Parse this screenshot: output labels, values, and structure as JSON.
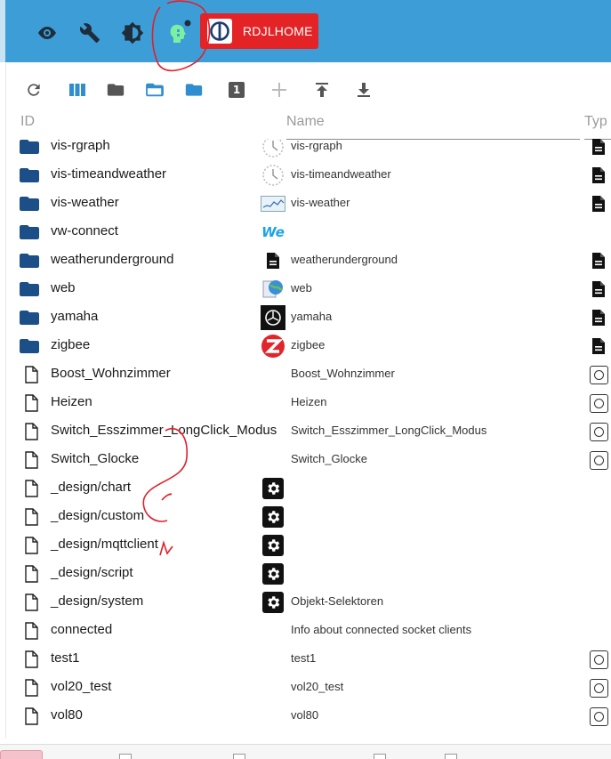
{
  "appbar": {
    "icons": [
      "eye-icon",
      "wrench-icon",
      "brightness-icon",
      "expert-mode-icon"
    ],
    "brand_label": "RDJLHOME"
  },
  "toolbar": {
    "icons": [
      "refresh-icon",
      "columns-icon",
      "folder-icon",
      "folder-open-icon",
      "folder-blue-icon",
      "number-badge-icon",
      "add-icon",
      "upload-icon",
      "download-icon"
    ],
    "badge_value": "1"
  },
  "columns": {
    "id": "ID",
    "name": "Name",
    "type": "Typ"
  },
  "rows": [
    {
      "id": "vis-rgraph",
      "name": "vis-rgraph",
      "kind": "folder",
      "name_icon": "clock-icon",
      "type_icon": "document-icon"
    },
    {
      "id": "vis-timeandweather",
      "name": "vis-timeandweather",
      "kind": "folder",
      "name_icon": "clock-icon",
      "type_icon": "document-icon"
    },
    {
      "id": "vis-weather",
      "name": "vis-weather",
      "kind": "folder",
      "name_icon": "weather-chart-icon",
      "type_icon": "document-icon"
    },
    {
      "id": "vw-connect",
      "name": "",
      "kind": "folder",
      "name_icon": "vw-logo-icon",
      "name_icon_text": "We",
      "type_icon": ""
    },
    {
      "id": "weatherunderground",
      "name": "weatherunderground",
      "kind": "folder",
      "name_icon": "document-icon",
      "type_icon": "document-icon"
    },
    {
      "id": "web",
      "name": "web",
      "kind": "folder",
      "name_icon": "globe-icon",
      "type_icon": "document-icon"
    },
    {
      "id": "yamaha",
      "name": "yamaha",
      "kind": "folder",
      "name_icon": "yamaha-logo-icon",
      "type_icon": "document-icon"
    },
    {
      "id": "zigbee",
      "name": "zigbee",
      "kind": "folder",
      "name_icon": "zigbee-logo-icon",
      "type_icon": "document-icon"
    },
    {
      "id": "Boost_Wohnzimmer",
      "name": "Boost_Wohnzimmer",
      "kind": "file",
      "name_icon": "",
      "type_icon": "state-icon"
    },
    {
      "id": "Heizen",
      "name": "Heizen",
      "kind": "file",
      "name_icon": "",
      "type_icon": "state-icon"
    },
    {
      "id": "Switch_Esszimmer_LongClick_Modus",
      "name": "Switch_Esszimmer_LongClick_Modus",
      "kind": "file",
      "name_icon": "",
      "type_icon": "state-icon"
    },
    {
      "id": "Switch_Glocke",
      "name": "Switch_Glocke",
      "kind": "file",
      "name_icon": "",
      "type_icon": "state-icon"
    },
    {
      "id": "_design/chart",
      "name": "",
      "kind": "file",
      "name_icon": "gear-icon",
      "type_icon": ""
    },
    {
      "id": "_design/custom",
      "name": "",
      "kind": "file",
      "name_icon": "gear-icon",
      "type_icon": ""
    },
    {
      "id": "_design/mqttclient",
      "name": "",
      "kind": "file",
      "name_icon": "gear-icon",
      "type_icon": ""
    },
    {
      "id": "_design/script",
      "name": "",
      "kind": "file",
      "name_icon": "gear-icon",
      "type_icon": ""
    },
    {
      "id": "_design/system",
      "name": "Objekt-Selektoren",
      "kind": "file",
      "name_icon": "gear-icon",
      "type_icon": ""
    },
    {
      "id": "connected",
      "name": "Info about connected socket clients",
      "kind": "file",
      "name_icon": "",
      "type_icon": ""
    },
    {
      "id": "test1",
      "name": "test1",
      "kind": "file",
      "name_icon": "",
      "type_icon": "state-icon"
    },
    {
      "id": "vol20_test",
      "name": "vol20_test",
      "kind": "file",
      "name_icon": "",
      "type_icon": "state-icon"
    },
    {
      "id": "vol80",
      "name": "vol80",
      "kind": "file",
      "name_icon": "",
      "type_icon": "state-icon"
    }
  ],
  "colors": {
    "appbar": "#3d9ed7",
    "brand": "#e42326",
    "folder": "#1c4f88",
    "toolbar_icon": "#2e8ed0",
    "annotation": "#e0202a"
  }
}
